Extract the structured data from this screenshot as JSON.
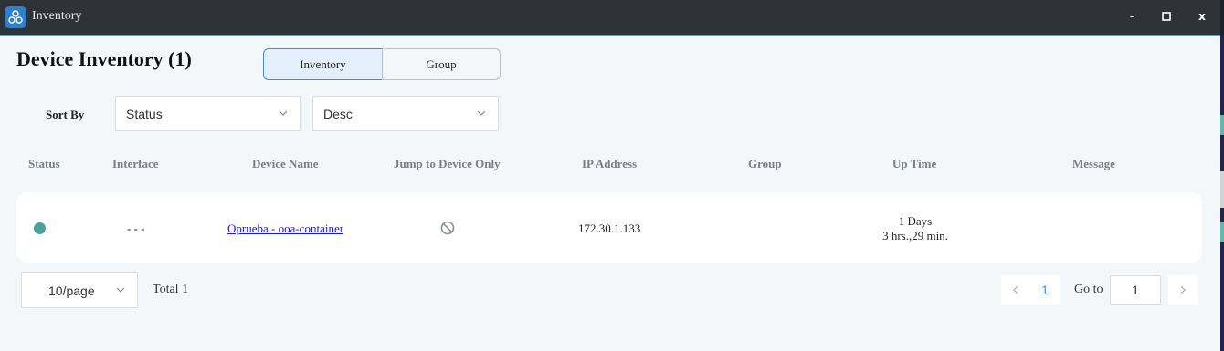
{
  "window": {
    "title": "Inventory",
    "minimize": "-",
    "maximize": "◻",
    "close": "x"
  },
  "page": {
    "title": "Device Inventory (1)",
    "tabs": [
      {
        "label": "Inventory",
        "active": true
      },
      {
        "label": "Group",
        "active": false
      }
    ]
  },
  "sort": {
    "label": "Sort By",
    "field": "Status",
    "order": "Desc"
  },
  "table": {
    "columns": [
      "Status",
      "Interface",
      "Device Name",
      "Jump to Device Only",
      "IP Address",
      "Group",
      "Up Time",
      "Message"
    ],
    "rows": [
      {
        "status": "online",
        "status_color": "#4aa39a",
        "interface": "- - -",
        "device_name": "Oprueba - ooa-container",
        "jump_icon": "ban-icon",
        "ip_address": "172.30.1.133",
        "group": "",
        "up_time_line1": "1 Days",
        "up_time_line2": "3 hrs.,29 min.",
        "message": ""
      }
    ]
  },
  "pagination": {
    "page_size": "10/page",
    "total": "Total 1",
    "current_page": "1",
    "goto_label": "Go to",
    "goto_value": "1"
  }
}
